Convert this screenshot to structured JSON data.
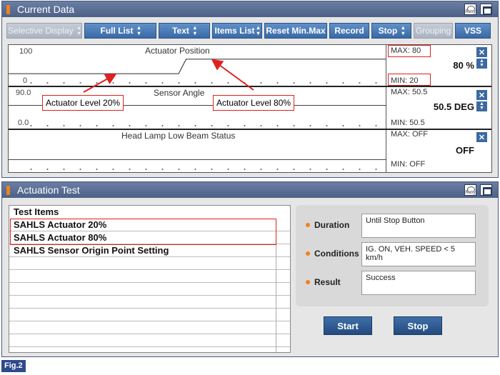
{
  "current_data": {
    "title": "Current Data",
    "retry_label": "Retry"
  },
  "toolbar": {
    "selective_display": "Selective Display",
    "full_list": "Full List",
    "text": "Text",
    "items_list": "Items List",
    "reset_min_max": "Reset Min.Max",
    "record": "Record",
    "stop": "Stop",
    "grouping": "Grouping",
    "vss": "VSS"
  },
  "graphs": [
    {
      "title": "Actuator Position",
      "y_max": "100",
      "y_min": "0",
      "max": "MAX: 80",
      "min": "MIN: 20",
      "current": "80 %",
      "series": [
        20,
        20,
        80,
        80
      ],
      "x": [
        0,
        0.45,
        0.47,
        1.0
      ]
    },
    {
      "title": "Sensor Angle",
      "y_max": "90.0",
      "y_min": "0.0",
      "max": "MAX: 50.5",
      "min": "MIN: 50.5",
      "current": "50.5 DEG"
    },
    {
      "title": "Head Lamp Low Beam Status",
      "max": "MAX: OFF",
      "min": "MIN: OFF",
      "current": "OFF"
    }
  ],
  "callouts": {
    "level20": "Actuator Level 20%",
    "level80": "Actuator Level 80%"
  },
  "actuation_test": {
    "title": "Actuation Test",
    "retry_label": "Retry",
    "list_header": "Test Items",
    "items": [
      "SAHLS Actuator 20%",
      "SAHLS Actuator 80%",
      "SAHLS Sensor Origin Point Setting"
    ],
    "duration_label": "Duration",
    "duration_value": "Until Stop Button",
    "conditions_label": "Conditions",
    "conditions_value": "IG. ON, VEH. SPEED < 5 km/h",
    "result_label": "Result",
    "result_value": "Success",
    "start_label": "Start",
    "stop_label": "Stop"
  },
  "fig_label": "Fig.2",
  "colors": {
    "accent": "#3b6aa3",
    "highlight": "#e02020",
    "indicator": "#f08020"
  }
}
